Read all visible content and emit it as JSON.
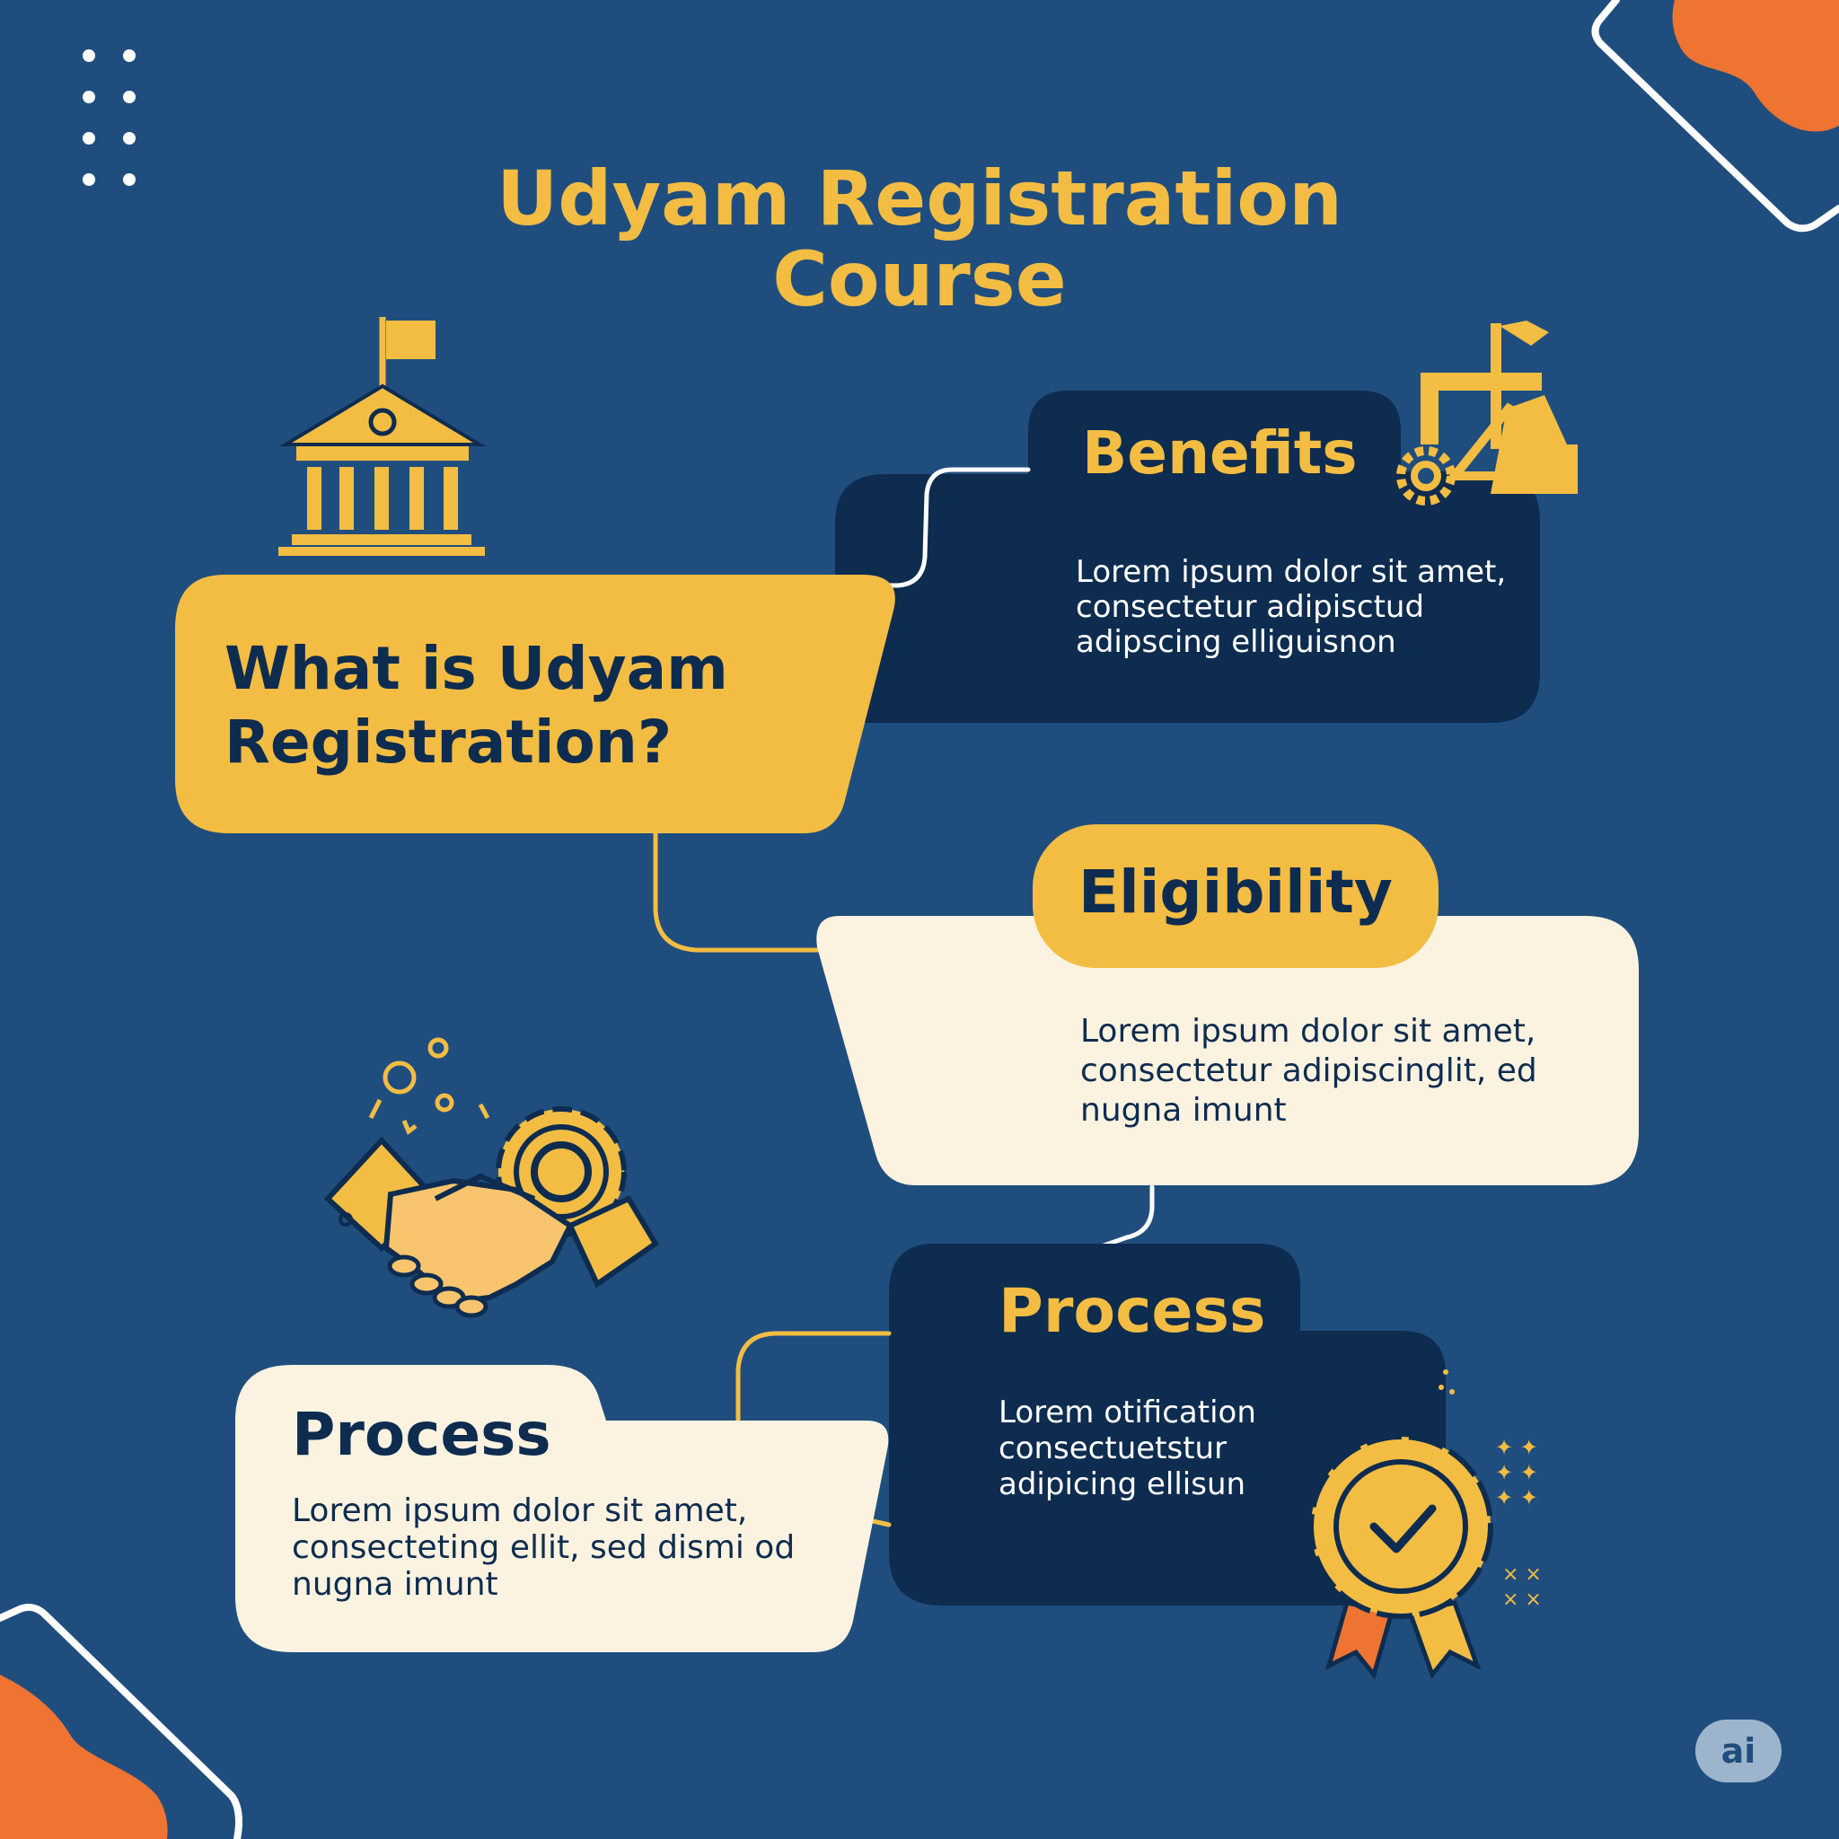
{
  "title": {
    "line1": "Udyam Registration",
    "line2": "Course"
  },
  "what_is": {
    "heading_line1": "What is Udyam",
    "heading_line2": "Registration?"
  },
  "benefits": {
    "heading": "Benefits",
    "body": "Lorem ipsum dolor sit amet,\nconsectetur adipisctud\nadipscing elliguisnon"
  },
  "eligibility": {
    "heading": "Eligibility",
    "body": "Lorem ipsum dolor sit amet,\nconsectetur adipiscinglit, ed\nnugna imunt"
  },
  "process_left": {
    "heading": "Process",
    "body": "Lorem ipsum dolor sit amet,\nconsecteting ellit, sed dismi od\nnugna imunt"
  },
  "process_right": {
    "heading": "Process",
    "body": "Lorem otification\nconsectuetstur\nadipicing ellisun"
  },
  "badge": {
    "label": "ai"
  },
  "colors": {
    "background": "#1f4e7e",
    "yellow": "#f3bd43",
    "navy": "#0e2c4f",
    "cream": "#fbf3e0",
    "orange": "#ef7331"
  },
  "icons": [
    "government-building-icon",
    "factory-gear-icon",
    "handshake-gear-icon",
    "award-ribbon-icon",
    "dot-grid-decoration",
    "sparkle-decoration"
  ]
}
